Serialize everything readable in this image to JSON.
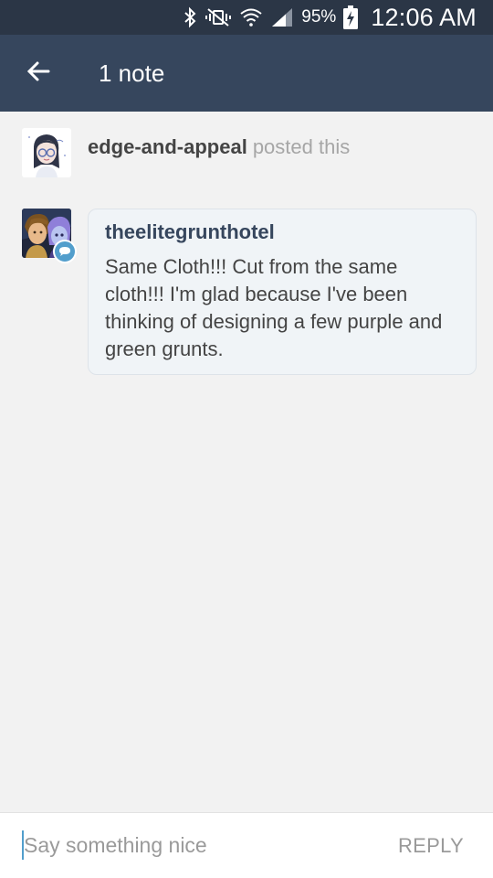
{
  "status_bar": {
    "icons": [
      "bluetooth-icon",
      "vibrate-mute-icon",
      "wifi-icon",
      "signal-icon",
      "battery-charging-icon"
    ],
    "battery_percent": "95%",
    "time": "12:06 AM"
  },
  "app_bar": {
    "back_icon": "arrow-left-icon",
    "title": "1 note"
  },
  "notes": {
    "post": {
      "username": "edge-and-appeal",
      "action": "posted this"
    },
    "reply": {
      "username": "theelitegrunthotel",
      "text": "Same Cloth!!! Cut from the same cloth!!! I'm glad because I've been thinking of designing a few purple and green grunts.",
      "badge_icon": "speech-bubble-icon"
    }
  },
  "compose": {
    "placeholder": "Say something nice",
    "reply_label": "REPLY"
  },
  "colors": {
    "status_bar": "#2b3646",
    "app_bar": "#36465d",
    "background": "#f2f2f2",
    "accent": "#529ecc"
  }
}
